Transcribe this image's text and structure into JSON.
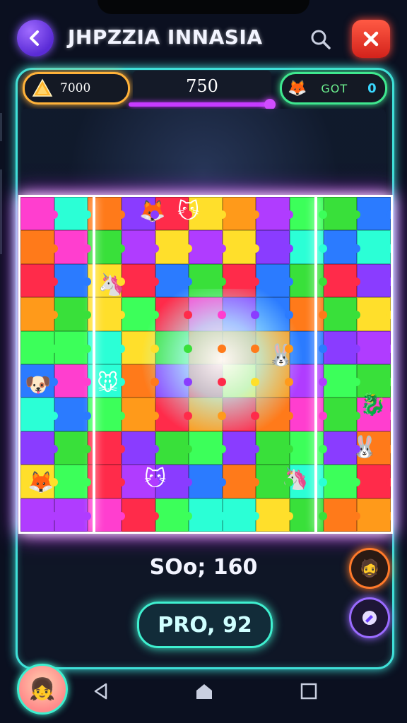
{
  "header": {
    "title": "JHPZZIA INNASIA"
  },
  "stats": {
    "coins": "7000",
    "center_value": "750",
    "progress": 1.0,
    "got_label": "GOT",
    "got_count": "0"
  },
  "board": {
    "colors": [
      "#ff3ecf",
      "#3cff5a",
      "#ffdf2b",
      "#ff7a1a",
      "#2b7bff",
      "#b03cff",
      "#ff2b4a",
      "#2bffd6",
      "#39e03a",
      "#ff9a1a",
      "#8a3cff"
    ],
    "creatures": [
      "🦊",
      "🐱",
      "🦄",
      "🐰",
      "🐶",
      "🐭",
      "🐉"
    ]
  },
  "footer": {
    "score_text": "SOo; 160",
    "play_label": "PRO, 92"
  },
  "icons": {
    "back": "back-arrow-icon",
    "search": "search-icon",
    "close": "close-icon",
    "coin": "coin-icon",
    "got": "creature-icon",
    "orange_side": "character-icon",
    "purple_side": "edit-icon",
    "nav_back": "triangle-back-icon",
    "nav_home": "home-icon",
    "nav_recent": "square-recent-icon"
  }
}
